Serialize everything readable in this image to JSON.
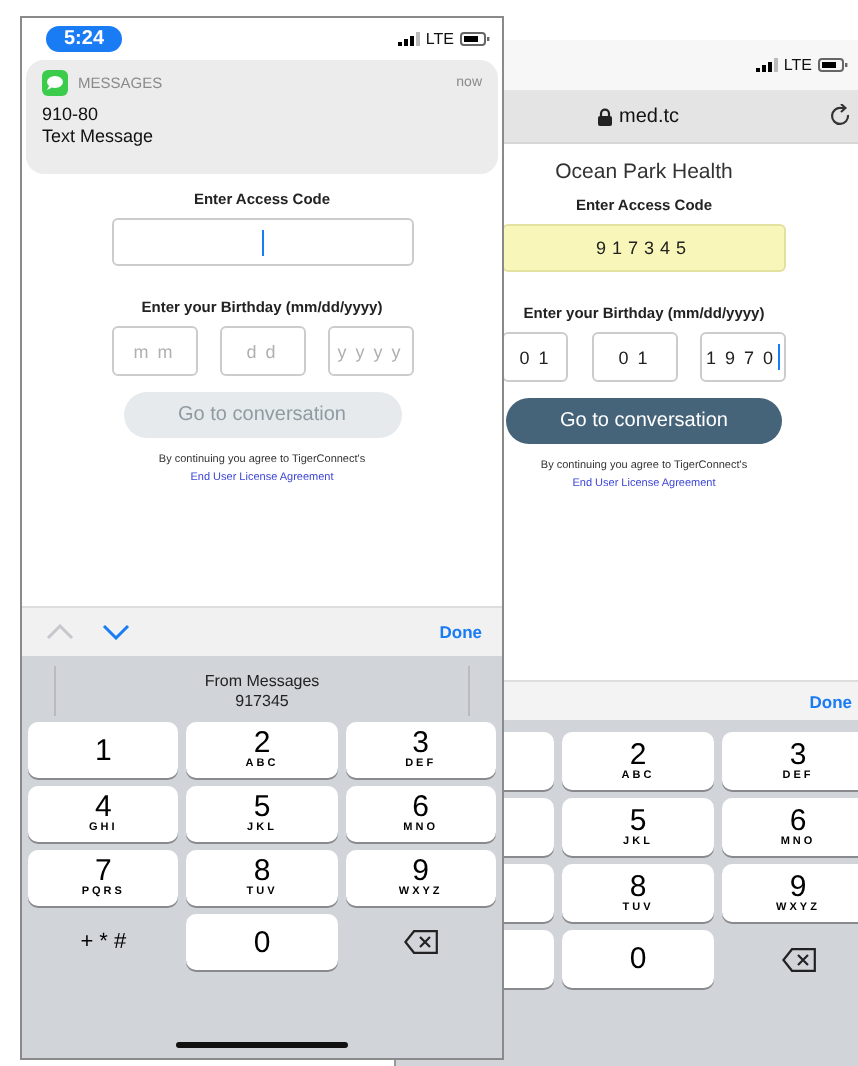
{
  "back_screen": {
    "status_bar": {
      "network": "LTE"
    },
    "url_bar": {
      "url": "med.tc"
    },
    "org_name": "Ocean Park Health",
    "access_code": {
      "label": "Enter Access Code",
      "value": "917345",
      "autofilled": true
    },
    "birthday": {
      "label": "Enter your Birthday (mm/dd/yyyy)",
      "fields": [
        {
          "value": "0 1",
          "focused": false
        },
        {
          "value": "0 1",
          "focused": false
        },
        {
          "value": "1 9 7 0",
          "focused": true
        }
      ]
    },
    "button": {
      "label": "Go to conversation",
      "disabled": false
    },
    "terms": {
      "text": "By continuing you agree to TigerConnect's",
      "link": "End User License Agreement"
    },
    "keyboard": {
      "done": "Done",
      "rows": [
        [
          {
            "kind": "digit",
            "digit": "2",
            "letters": "ABC"
          },
          {
            "kind": "digit",
            "digit": "3",
            "letters": "DEF"
          }
        ],
        [
          {
            "kind": "digit",
            "digit": "5",
            "letters": "JKL"
          },
          {
            "kind": "digit",
            "digit": "6",
            "letters": "MNO"
          }
        ],
        [
          {
            "kind": "digit",
            "digit": "8",
            "letters": "TUV"
          },
          {
            "kind": "digit",
            "digit": "9",
            "letters": "WXYZ"
          }
        ],
        [
          {
            "kind": "digit",
            "digit": "0"
          },
          {
            "kind": "delete"
          }
        ]
      ]
    }
  },
  "front_screen": {
    "status_bar": {
      "time": "5:24",
      "network": "LTE"
    },
    "notification": {
      "app": "MESSAGES",
      "time": "now",
      "sender": "910-80",
      "body": "Text Message"
    },
    "access_code": {
      "label": "Enter Access Code",
      "focused": true
    },
    "birthday": {
      "label": "Enter your Birthday (mm/dd/yyyy)",
      "fields": [
        {
          "placeholder": "m m"
        },
        {
          "placeholder": "d d"
        },
        {
          "placeholder": "y y y y"
        }
      ]
    },
    "button": {
      "label": "Go to conversation",
      "disabled": true
    },
    "terms": {
      "text": "By continuing you agree to TigerConnect's",
      "link": "End User License Agreement"
    },
    "toolbar": {
      "arrows": [
        {
          "kind": "up",
          "disabled": true
        },
        {
          "kind": "down",
          "disabled": false
        }
      ],
      "done": "Done"
    },
    "suggestion": {
      "source": "From Messages",
      "code": "917345"
    },
    "keyboard": {
      "rows": [
        [
          {
            "kind": "digit",
            "digit": "1"
          },
          {
            "kind": "digit",
            "digit": "2",
            "letters": "ABC"
          },
          {
            "kind": "digit",
            "digit": "3",
            "letters": "DEF"
          }
        ],
        [
          {
            "kind": "digit",
            "digit": "4",
            "letters": "GHI"
          },
          {
            "kind": "digit",
            "digit": "5",
            "letters": "JKL"
          },
          {
            "kind": "digit",
            "digit": "6",
            "letters": "MNO"
          }
        ],
        [
          {
            "kind": "digit",
            "digit": "7",
            "letters": "PQRS"
          },
          {
            "kind": "digit",
            "digit": "8",
            "letters": "TUV"
          },
          {
            "kind": "digit",
            "digit": "9",
            "letters": "WXYZ"
          }
        ],
        [
          {
            "kind": "symbols",
            "label": "+ * #"
          },
          {
            "kind": "digit",
            "digit": "0"
          },
          {
            "kind": "delete"
          }
        ]
      ]
    }
  }
}
